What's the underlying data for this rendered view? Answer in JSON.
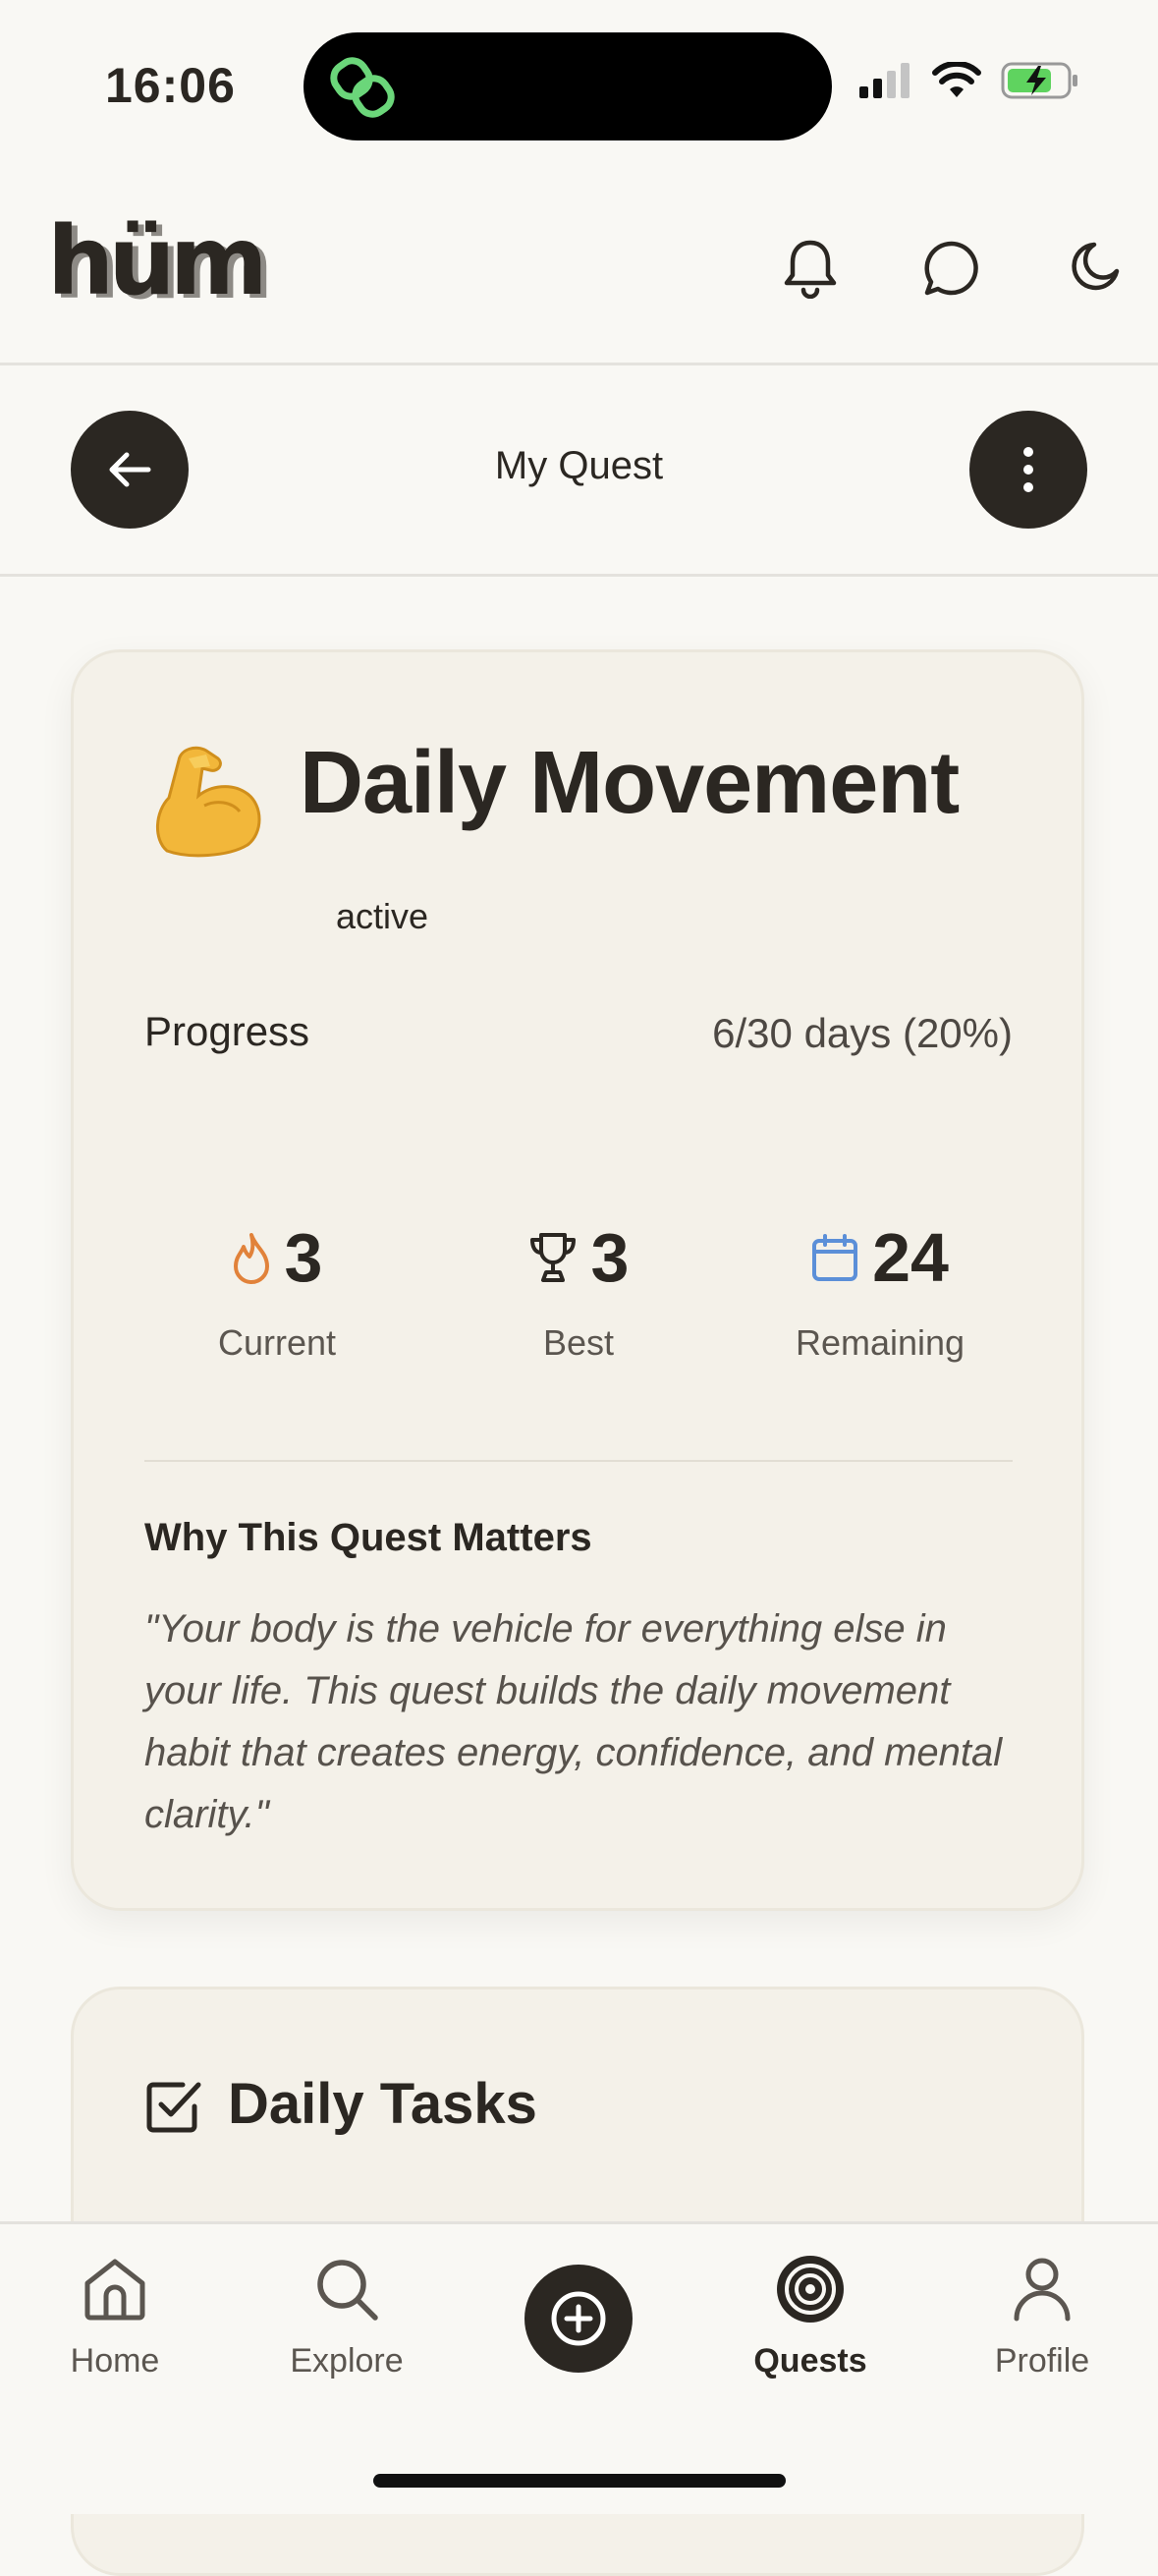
{
  "status_bar": {
    "time": "16:06"
  },
  "header": {
    "logo": "hüm",
    "icons": [
      "bell-icon",
      "chat-bubble-icon",
      "moon-icon"
    ]
  },
  "subheader": {
    "title": "My Quest",
    "back_icon": "arrow-left-icon",
    "more_icon": "more-vertical-icon"
  },
  "quest": {
    "emoji": "flexed-biceps",
    "title": "Daily Movement",
    "status": "active",
    "progress_label": "Progress",
    "progress_value": "6/30 days (20%)",
    "progress_fraction": 0.2,
    "stats": [
      {
        "icon": "flame-icon",
        "value": "3",
        "label": "Current",
        "color": "#e1823a"
      },
      {
        "icon": "trophy-icon",
        "value": "3",
        "label": "Best",
        "color": "#2b2722"
      },
      {
        "icon": "calendar-icon",
        "value": "24",
        "label": "Remaining",
        "color": "#5b8fd8"
      }
    ],
    "why_title": "Why This Quest Matters",
    "why_text": "\"Your body is the vehicle for everything else in your life. This quest builds the daily movement habit that creates energy, confidence, and mental clarity.\""
  },
  "tasks": {
    "title": "Daily Tasks"
  },
  "nav": {
    "items": [
      {
        "label": "Home",
        "icon": "home-icon"
      },
      {
        "label": "Explore",
        "icon": "search-icon"
      },
      {
        "label": "",
        "icon": "plus-circle-icon"
      },
      {
        "label": "Quests",
        "icon": "target-icon",
        "active": true
      },
      {
        "label": "Profile",
        "icon": "user-icon"
      }
    ]
  },
  "colors": {
    "background": "#f9f8f4",
    "card": "#f4f1e9",
    "ink": "#2b2722"
  }
}
